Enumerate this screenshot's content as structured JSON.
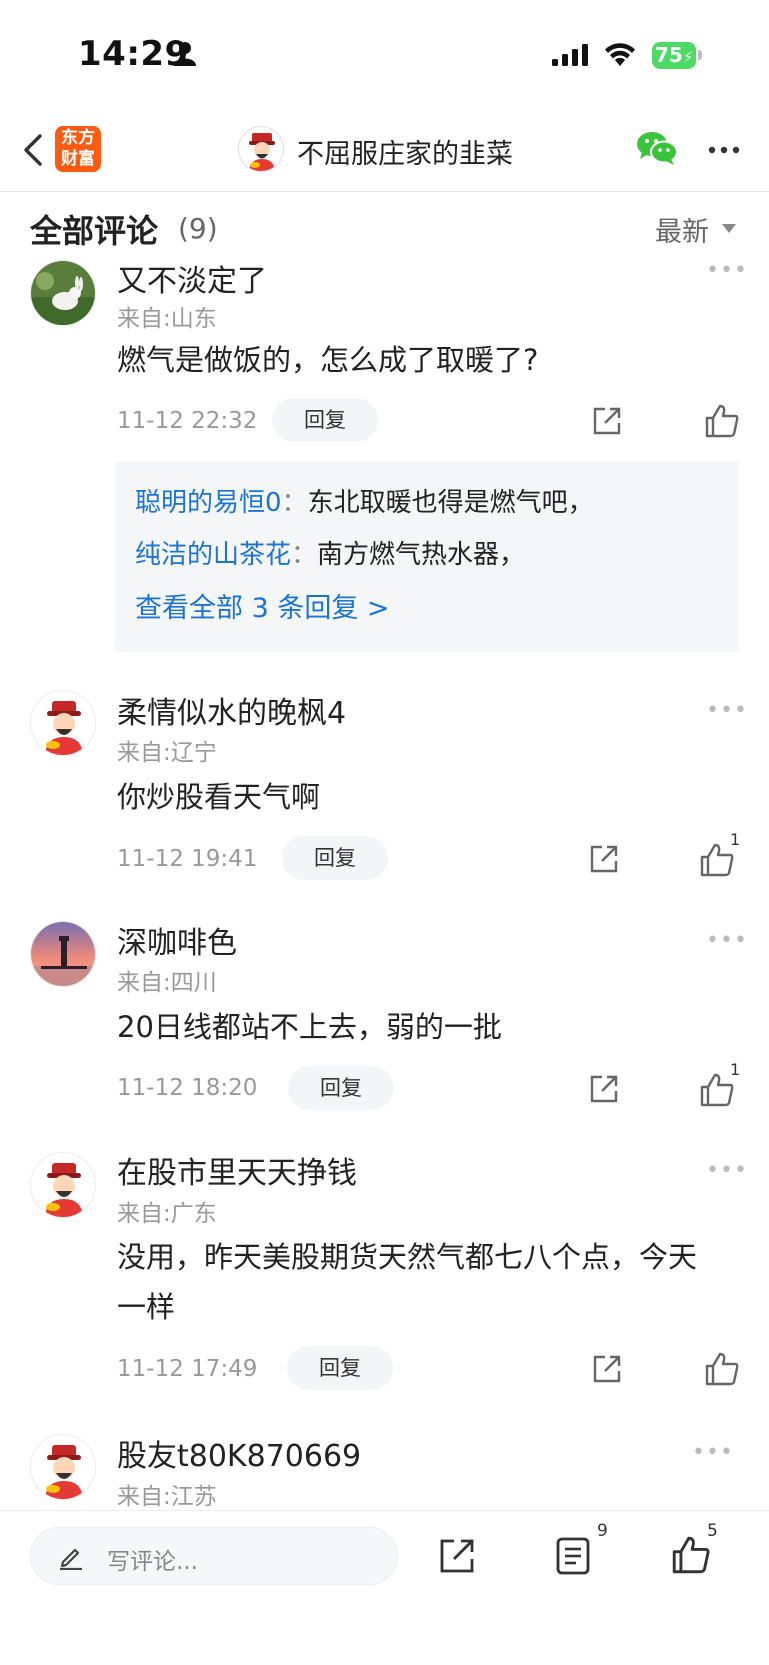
{
  "status_bar": {
    "time": "14:29",
    "battery": "75"
  },
  "nav": {
    "logo_line1": "东方",
    "logo_line2": "财富",
    "title": "不屈服庄家的韭菜"
  },
  "comments_header": {
    "title": "全部评论",
    "count": "(9)",
    "sort": "最新"
  },
  "comments": [
    {
      "username": "又不淡定了",
      "location": "来自:山东",
      "text": "燃气是做饭的，怎么成了取暖了?",
      "timestamp": "11-12 22:32",
      "reply_label": "回复",
      "likes": "",
      "replies": [
        {
          "user": "聪明的易恒0",
          "text": "东北取暖也得是燃气吧，"
        },
        {
          "user": "纯洁的山茶花",
          "text": "南方燃气热水器，"
        }
      ],
      "view_all": "查看全部 3 条回复 >"
    },
    {
      "username": "柔情似水的晚枫4",
      "location": "来自:辽宁",
      "text": "你炒股看天气啊",
      "timestamp": "11-12 19:41",
      "reply_label": "回复",
      "likes": "1"
    },
    {
      "username": "深咖啡色",
      "location": "来自:四川",
      "text": "20日线都站不上去，弱的一批",
      "timestamp": "11-12 18:20",
      "reply_label": "回复",
      "likes": "1"
    },
    {
      "username": "在股市里天天挣钱",
      "location": "来自:广东",
      "text": "没用，昨天美股期货天然气都七八个点，今天一样",
      "timestamp": "11-12 17:49",
      "reply_label": "回复",
      "likes": ""
    },
    {
      "username": "股友t80K870669",
      "location": "来自:江苏"
    }
  ],
  "bottom_bar": {
    "input_placeholder": "写评论...",
    "comment_count": "9",
    "like_count": "5"
  },
  "colors": {
    "link_blue": "#1a73d9",
    "brand_orange": "#ff5a12",
    "battery_green": "#4cd964",
    "wechat_green": "#3bc43b"
  },
  "icons": [
    "back-icon",
    "wechat-icon",
    "more-icon",
    "share-icon",
    "like-icon",
    "pencil-icon",
    "comments-list-icon"
  ]
}
